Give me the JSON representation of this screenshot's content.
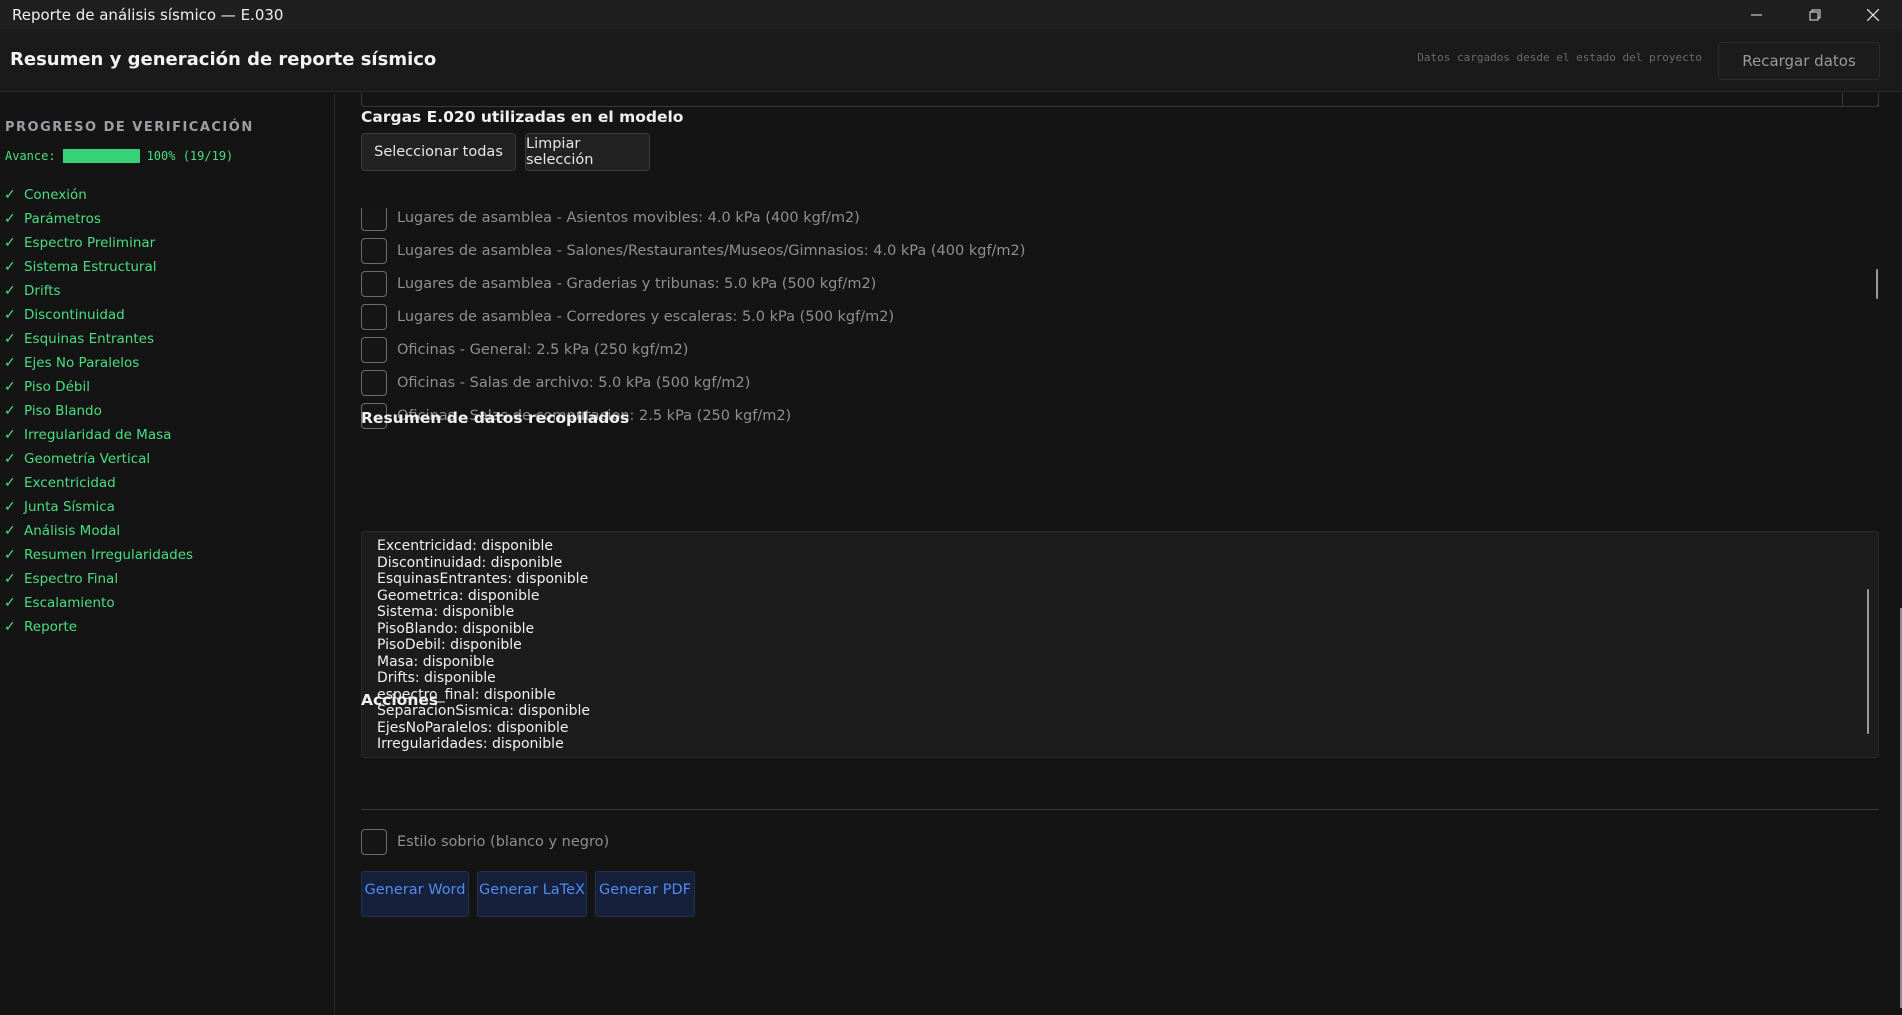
{
  "window": {
    "title": "Reporte de análisis sísmico — E.030"
  },
  "header": {
    "title": "Resumen y generación de reporte sísmico",
    "status_note": "Datos cargados desde el estado del proyecto",
    "reload_label": "Recargar datos"
  },
  "sidebar": {
    "heading": "PROGRESO DE VERIFICACIÓN",
    "progress_label": "Avance:",
    "progress_fraction": 1.0,
    "progress_text": "100% (19/19)",
    "check_glyph": "✓",
    "items": [
      "Conexión",
      "Parámetros",
      "Espectro Preliminar",
      "Sistema Estructural",
      "Drifts",
      "Discontinuidad",
      "Esquinas Entrantes",
      "Ejes No Paralelos",
      "Piso Débil",
      "Piso Blando",
      "Irregularidad de Masa",
      "Geometría Vertical",
      "Excentricidad",
      "Junta Sísmica",
      "Análisis Modal",
      "Resumen Irregularidades",
      "Espectro Final",
      "Escalamiento",
      "Reporte"
    ]
  },
  "loads": {
    "title": "Cargas E.020 utilizadas en el modelo",
    "select_all_label": "Seleccionar todas",
    "clear_label": "Limpiar selección",
    "items": [
      "Lugares de asamblea - Asientos movibles: 4.0 kPa (400 kgf/m2)",
      "Lugares de asamblea - Salones/Restaurantes/Museos/Gimnasios: 4.0 kPa (400 kgf/m2)",
      "Lugares de asamblea - Graderias y tribunas: 5.0 kPa (500 kgf/m2)",
      "Lugares de asamblea - Corredores y escaleras: 5.0 kPa (500 kgf/m2)",
      "Oficinas - General: 2.5 kPa (250 kgf/m2)",
      "Oficinas - Salas de archivo: 5.0 kPa (500 kgf/m2)",
      "Oficinas - Salas de computacion: 2.5 kPa (250 kgf/m2)"
    ]
  },
  "summary": {
    "title": "Resumen de datos recopilados",
    "lines": [
      "Excentricidad: disponible",
      "Discontinuidad: disponible",
      "EsquinasEntrantes: disponible",
      "Geometrica: disponible",
      "Sistema: disponible",
      "PisoBlando: disponible",
      "PisoDebil: disponible",
      "Masa: disponible",
      "Drifts: disponible",
      "espectro_final: disponible",
      "SeparacionSismica: disponible",
      "EjesNoParalelos: disponible",
      "Irregularidades: disponible"
    ]
  },
  "actions": {
    "title": "Acciones",
    "style_label": "Estilo sobrio (blanco y negro)",
    "word_label": "Generar Word",
    "latex_label": "Generar LaTeX",
    "pdf_label": "Generar PDF"
  },
  "colors": {
    "accent_green": "#4ade80",
    "accent_blue": "#4f8cf0"
  }
}
